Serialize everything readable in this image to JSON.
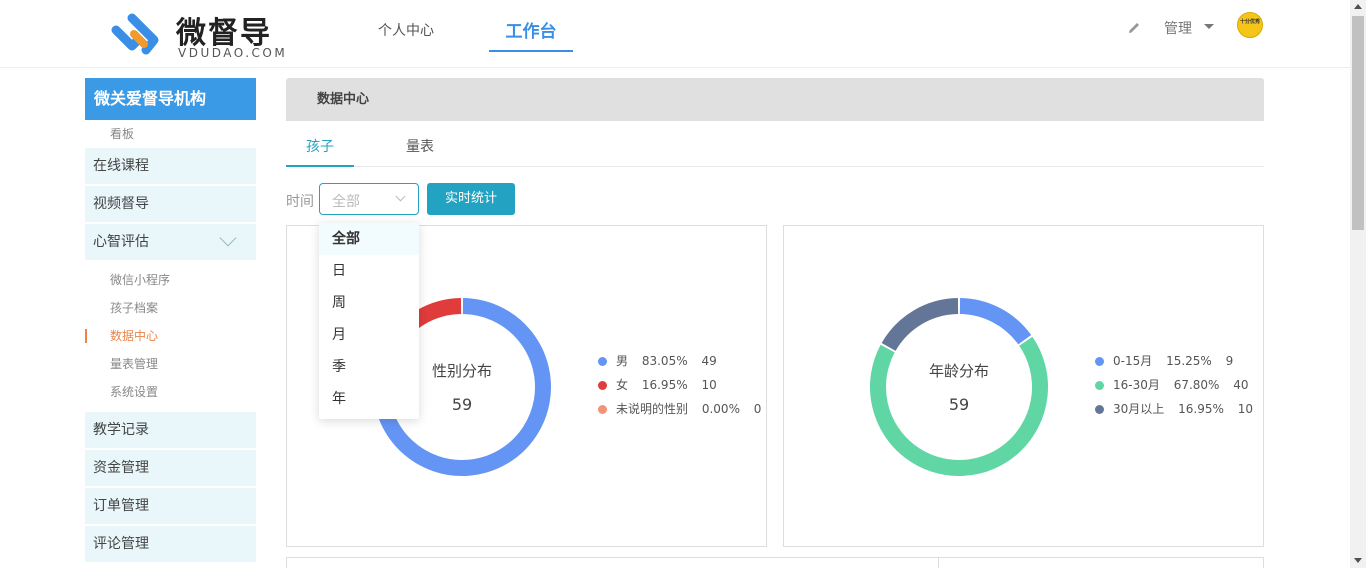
{
  "header": {
    "logo_text": "微督导",
    "logo_sub": "VDUDAO.COM",
    "nav_personal": "个人中心",
    "nav_workbench": "工作台",
    "admin_label": "管理",
    "avatar_text": "十分优秀",
    "accent": "#3a8ee6"
  },
  "sidebar": {
    "org": "微关爱督导机构",
    "top_sub": "看板",
    "menus": [
      {
        "label": "在线课程"
      },
      {
        "label": "视频督导"
      },
      {
        "label": "心智评估"
      }
    ],
    "sub_items": [
      {
        "label": "微信小程序"
      },
      {
        "label": "孩子档案"
      },
      {
        "label": "数据中心"
      },
      {
        "label": "量表管理"
      },
      {
        "label": "系统设置"
      }
    ],
    "menus_after": [
      {
        "label": "教学记录"
      },
      {
        "label": "资金管理"
      },
      {
        "label": "订单管理"
      },
      {
        "label": "评论管理"
      }
    ]
  },
  "main": {
    "page_title": "数据中心",
    "tabs": [
      {
        "label": "孩子"
      },
      {
        "label": "量表"
      }
    ],
    "time_label": "时间",
    "select_value": "全部",
    "stat_button": "实时统计",
    "dropdown_options": [
      "全部",
      "日",
      "周",
      "月",
      "季",
      "年"
    ]
  },
  "charts": {
    "gender": {
      "title": "性别分布",
      "total": "59",
      "legend": [
        {
          "name": "男",
          "percent": "83.05%",
          "count": "49",
          "color": "#6495f4"
        },
        {
          "name": "女",
          "percent": "16.95%",
          "count": "10",
          "color": "#e03c3c"
        },
        {
          "name": "未说明的性别",
          "percent": "0.00%",
          "count": "0",
          "color": "#f29277"
        }
      ]
    },
    "age": {
      "title": "年龄分布",
      "total": "59",
      "legend": [
        {
          "name": "0-15月",
          "percent": "15.25%",
          "count": "9",
          "color": "#6495f4"
        },
        {
          "name": "16-30月",
          "percent": "67.80%",
          "count": "40",
          "color": "#5fd6a4"
        },
        {
          "name": "30月以上",
          "percent": "16.95%",
          "count": "10",
          "color": "#647698"
        }
      ]
    }
  },
  "chart_data": [
    {
      "type": "pie",
      "title": "性别分布",
      "categories": [
        "男",
        "女",
        "未说明的性别"
      ],
      "values": [
        49,
        10,
        0
      ]
    },
    {
      "type": "pie",
      "title": "年龄分布",
      "categories": [
        "0-15月",
        "16-30月",
        "30月以上"
      ],
      "values": [
        9,
        40,
        10
      ]
    }
  ]
}
